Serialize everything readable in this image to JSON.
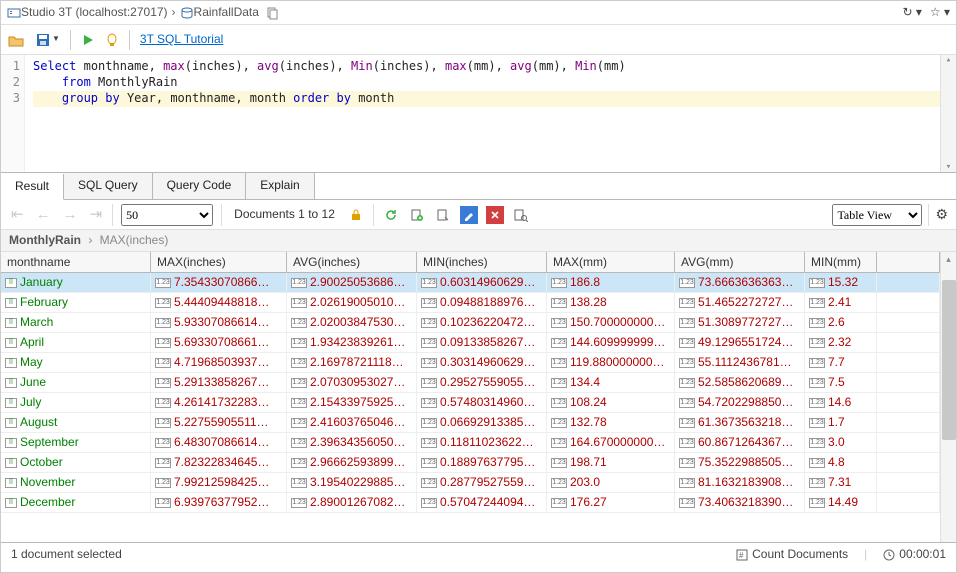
{
  "title": {
    "app": "Studio 3T (localhost:27017)",
    "db": "RainfallData"
  },
  "toolbar": {
    "link": "3T SQL Tutorial"
  },
  "editor": {
    "gutter": [
      "1",
      "2",
      "3"
    ],
    "t": {
      "select": "Select",
      "from": "from",
      "group": "group",
      "by": "by",
      "order": "order",
      "max": "max",
      "avg": "avg",
      "Min": "Min",
      "monthname": "monthname",
      "inches": "inches",
      "mm": "mm",
      "MonthlyRain": "MonthlyRain",
      "Year": "Year",
      "month": "month"
    }
  },
  "tabs": [
    "Result",
    "SQL Query",
    "Query Code",
    "Explain"
  ],
  "action": {
    "page_size": "50",
    "docs": "Documents 1 to 12",
    "view": "Table View"
  },
  "path": {
    "coll": "MonthlyRain",
    "field": "MAX(inches)"
  },
  "columns": [
    "monthname",
    "MAX(inches)",
    "AVG(inches)",
    "MIN(inches)",
    "MAX(mm)",
    "AVG(mm)",
    "MIN(mm)"
  ],
  "rows": [
    {
      "m": "January",
      "maxi": "7.35433070866…",
      "avgi": "2.90025053686…",
      "mini": "0.60314960629…",
      "maxm": "186.8",
      "avgm": "73.6663636363…",
      "minm": "15.32"
    },
    {
      "m": "February",
      "maxi": "5.44409448818…",
      "avgi": "2.02619005010…",
      "mini": "0.09488188976…",
      "maxm": "138.28",
      "avgm": "51.4652272727…",
      "minm": "2.41"
    },
    {
      "m": "March",
      "maxi": "5.93307086614…",
      "avgi": "2.02003847530…",
      "mini": "0.10236220472…",
      "maxm": "150.700000000…",
      "avgm": "51.3089772727…",
      "minm": "2.6"
    },
    {
      "m": "April",
      "maxi": "5.69330708661…",
      "avgi": "1.93423839261…",
      "mini": "0.09133858267…",
      "maxm": "144.609999999…",
      "avgm": "49.1296551724…",
      "minm": "2.32"
    },
    {
      "m": "May",
      "maxi": "4.71968503937…",
      "avgi": "2.16978721118…",
      "mini": "0.30314960629…",
      "maxm": "119.880000000…",
      "avgm": "55.1112436781…",
      "minm": "7.7"
    },
    {
      "m": "June",
      "maxi": "5.29133858267…",
      "avgi": "2.07030953027…",
      "mini": "0.29527559055…",
      "maxm": "134.4",
      "avgm": "52.5858620689…",
      "minm": "7.5"
    },
    {
      "m": "July",
      "maxi": "4.26141732283…",
      "avgi": "2.15433975925…",
      "mini": "0.57480314960…",
      "maxm": "108.24",
      "avgm": "54.7202298850…",
      "minm": "14.6"
    },
    {
      "m": "August",
      "maxi": "5.22755905511…",
      "avgi": "2.41603765046…",
      "mini": "0.06692913385…",
      "maxm": "132.78",
      "avgm": "61.3673563218…",
      "minm": "1.7"
    },
    {
      "m": "September",
      "maxi": "6.48307086614…",
      "avgi": "2.39634356050…",
      "mini": "0.11811023622…",
      "maxm": "164.670000000…",
      "avgm": "60.8671264367…",
      "minm": "3.0"
    },
    {
      "m": "October",
      "maxi": "7.82322834645…",
      "avgi": "2.96662593899…",
      "mini": "0.18897637795…",
      "maxm": "198.71",
      "avgm": "75.3522988505…",
      "minm": "4.8"
    },
    {
      "m": "November",
      "maxi": "7.99212598425…",
      "avgi": "3.19540229885…",
      "mini": "0.28779527559…",
      "maxm": "203.0",
      "avgm": "81.1632183908…",
      "minm": "7.31"
    },
    {
      "m": "December",
      "maxi": "6.93976377952…",
      "avgi": "2.89001267082…",
      "mini": "0.57047244094…",
      "maxm": "176.27",
      "avgm": "73.4063218390…",
      "minm": "14.49"
    }
  ],
  "status": {
    "sel": "1 document selected",
    "count": "Count Documents",
    "time": "00:00:01"
  }
}
